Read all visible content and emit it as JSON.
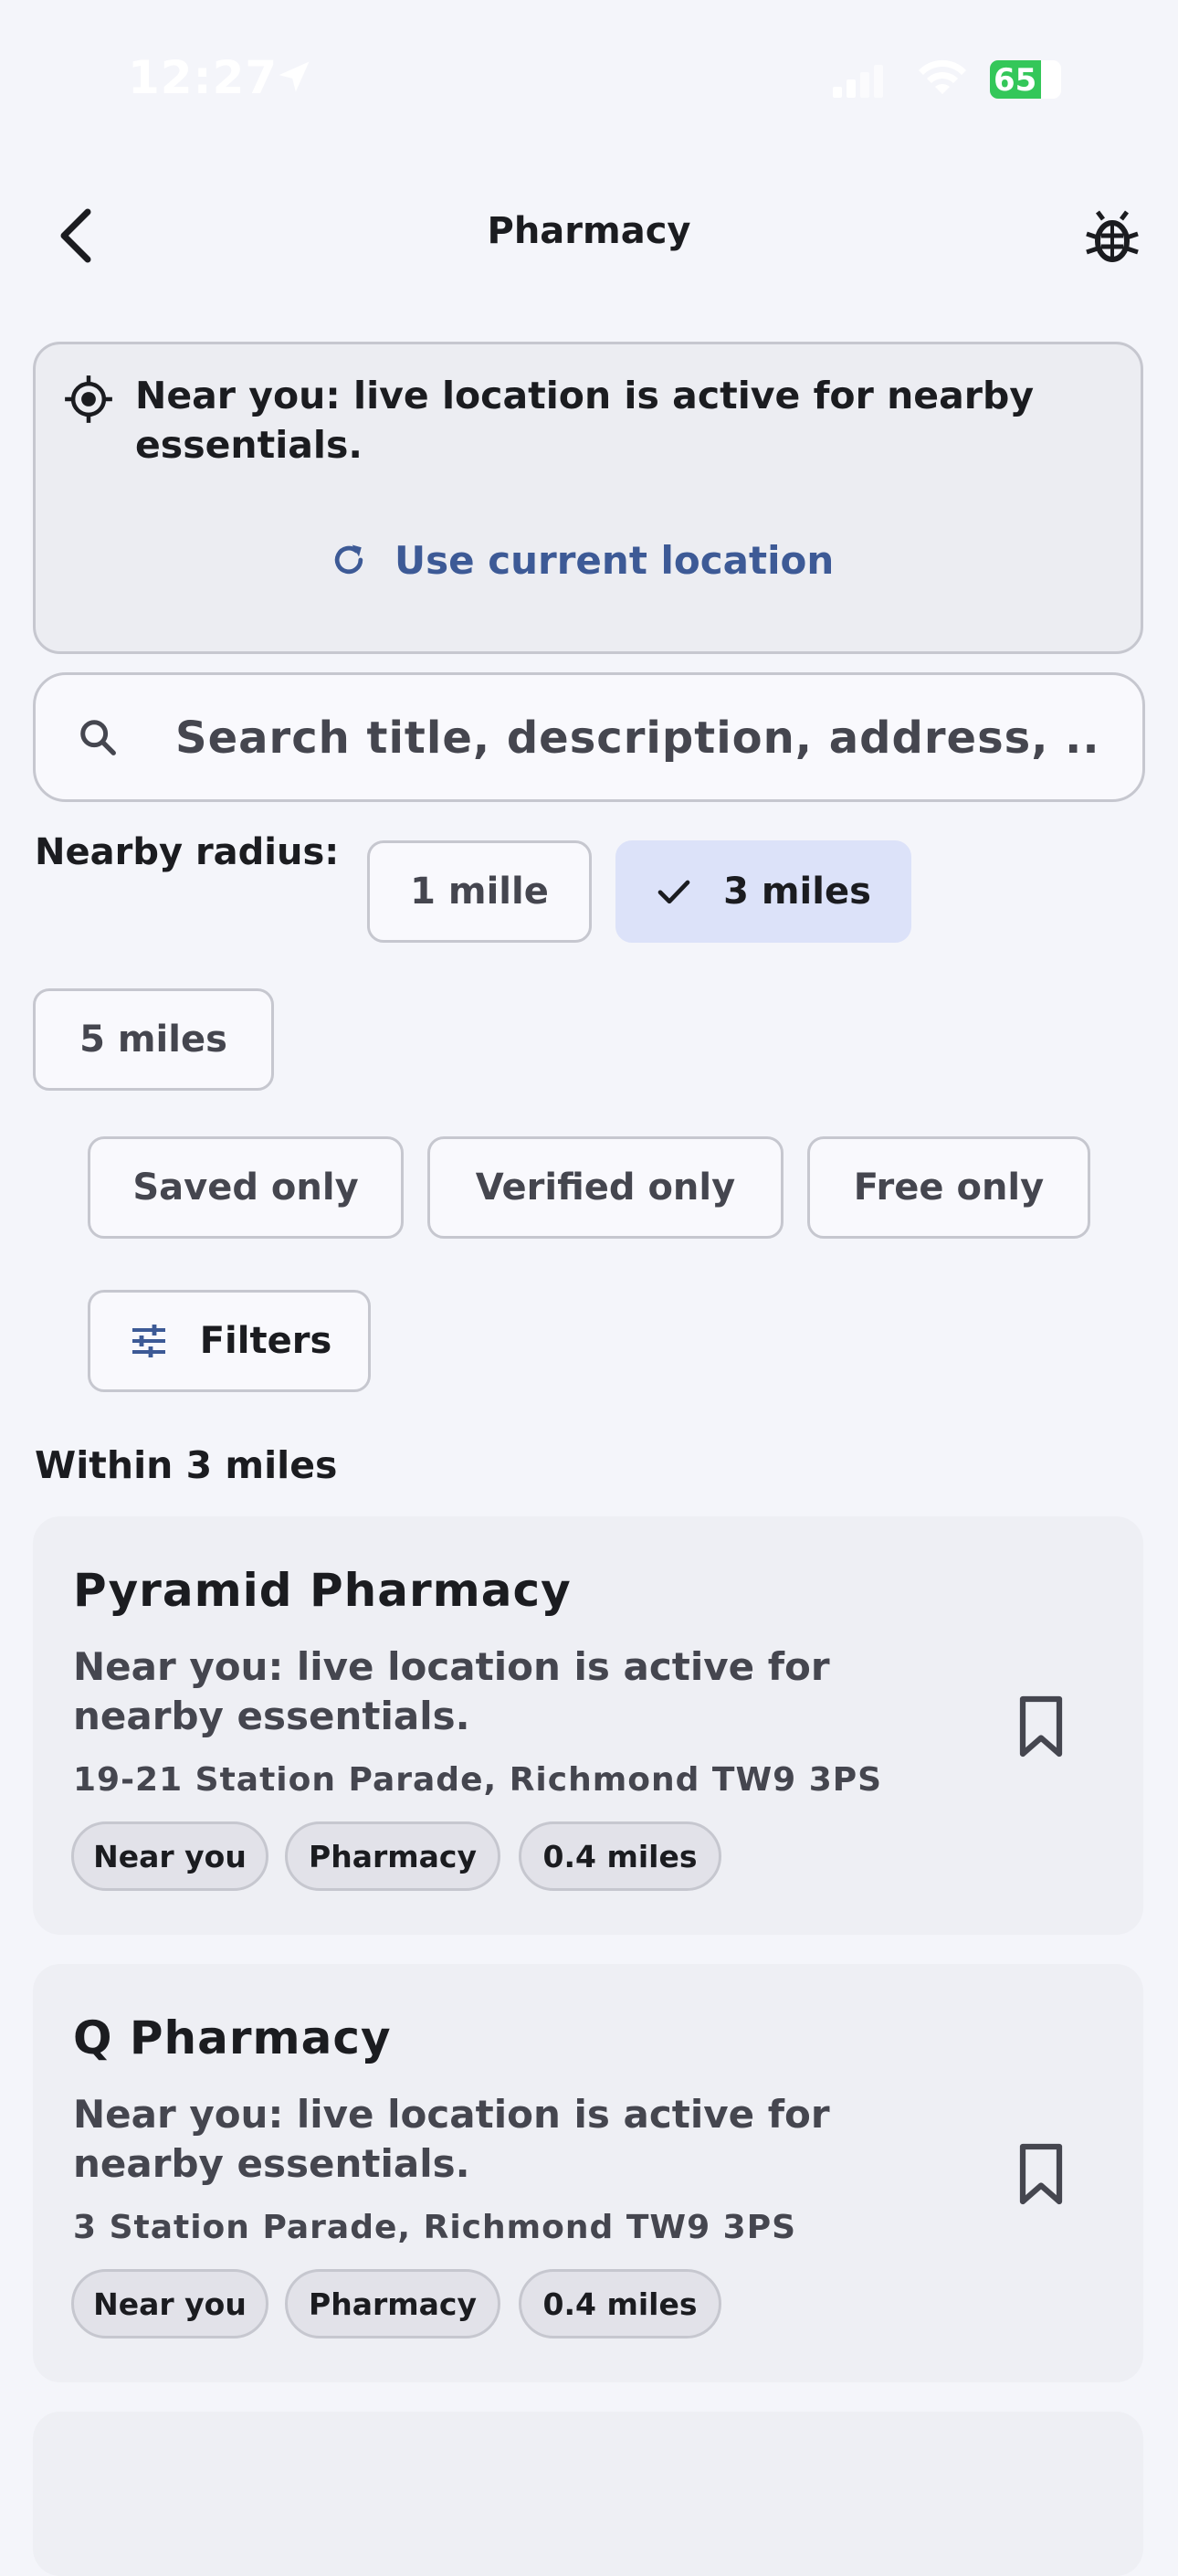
{
  "status_bar": {
    "time": "12:27",
    "battery": "65",
    "icons": [
      "location-arrow-icon",
      "signal-icon",
      "wifi-icon",
      "battery-icon"
    ]
  },
  "app_bar": {
    "title": "Pharmacy",
    "back_icon": "chevron-left-icon",
    "debug_icon": "bug-icon"
  },
  "location_card": {
    "message": "Near you: live location is active for nearby essentials.",
    "action_label": "Use current location"
  },
  "search": {
    "placeholder": "Search title, description, address, ..."
  },
  "radius": {
    "label": "Nearby radius:",
    "options": [
      "1 mille",
      "3 miles",
      "5 miles"
    ],
    "selected": "3 miles"
  },
  "filters": {
    "saved": "Saved only",
    "verified": "Verified only",
    "free": "Free only",
    "more": "Filters"
  },
  "section_title": "Within 3 miles",
  "results": [
    {
      "title": "Pyramid Pharmacy",
      "description": "Near you: live location is active for nearby essentials.",
      "address": "19-21 Station Parade, Richmond TW9 3PS",
      "tags": [
        "Near you",
        "Pharmacy",
        "0.4 miles"
      ]
    },
    {
      "title": "Q Pharmacy",
      "description": "Near you: live location is active for nearby essentials.",
      "address": "3 Station Parade, Richmond TW9 3PS",
      "tags": [
        "Near you",
        "Pharmacy",
        "0.4 miles"
      ]
    }
  ],
  "colors": {
    "background": "#f4f5fa",
    "accent": "#3d5a96",
    "selected_chip": "#dce2f9",
    "battery": "#34c759"
  }
}
